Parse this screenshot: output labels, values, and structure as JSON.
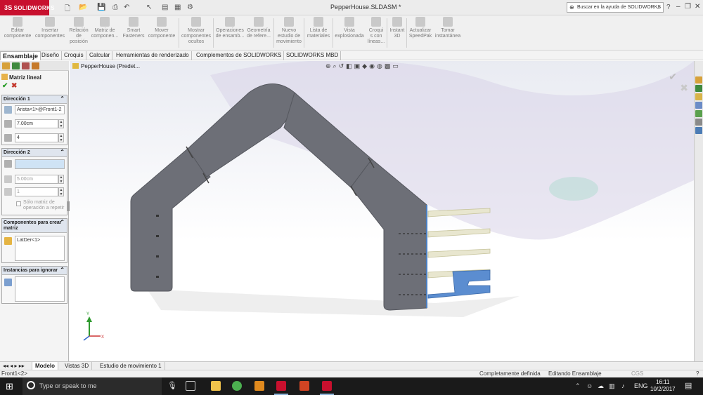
{
  "titlebar": {
    "logo_brand": "SOLIDWORKS",
    "logo_mark": "3S",
    "document_title": "PepperHouse.SLDASM *",
    "help_search_placeholder": "Buscar en la ayuda de SOLIDWORKS"
  },
  "command_manager": [
    {
      "label": "Editar\ncomponente"
    },
    {
      "label": "Insertar\ncomponentes"
    },
    {
      "label": "Relación\nde\nposición"
    },
    {
      "label": "Matriz de\ncomponen..."
    },
    {
      "label": "Smart\nFasteners"
    },
    {
      "label": "Mover\ncomponente"
    },
    {
      "label": "Mostrar\ncomponentes\nocultos"
    },
    {
      "label": "Operaciones\nde ensamb..."
    },
    {
      "label": "Geometría\nde refere..."
    },
    {
      "label": "Nuevo\nestudio de\nmovimiento"
    },
    {
      "label": "Lista de\nmateriales"
    },
    {
      "label": "Vista\nexplosionada"
    },
    {
      "label": "Croqui\ns con\nlíneas..."
    },
    {
      "label": "Instant\n3D"
    },
    {
      "label": "Actualizar\nSpeedPak"
    },
    {
      "label": "Tomar\ninstantánea"
    }
  ],
  "tabs": [
    "Ensamblaje",
    "Diseño",
    "Croquis",
    "Calcular",
    "Herramientas de renderizado",
    "Complementos de SOLIDWORKS",
    "SOLIDWORKS MBD"
  ],
  "property_manager": {
    "title": "Matriz lineal",
    "ok_glyph": "✔",
    "cancel_glyph": "✖",
    "direction1": {
      "header": "Dirección 1",
      "edge": "Arista<1>@Front1-2",
      "spacing": "7.00cm",
      "instances": "4"
    },
    "direction2": {
      "header": "Dirección 2",
      "edge": "",
      "spacing": "5.00cm",
      "instances": "1",
      "checkbox_label": "Sólo matriz de operación a repetir"
    },
    "components": {
      "header": "Componentes para crear matriz",
      "item": "LatDer<1>"
    },
    "skip": {
      "header": "Instancias para ignorar"
    }
  },
  "viewport": {
    "crumb": "PepperHouse  (Predet..."
  },
  "bottom_tabs": [
    "Modelo",
    "Vistas 3D",
    "Estudio de movimiento 1"
  ],
  "status": {
    "left": "Front1<2>",
    "defined": "Completamente definida",
    "mode": "Editando Ensamblaje",
    "units": "CGS"
  },
  "taskbar": {
    "search_placeholder": "Type or speak to me",
    "language": "ENG",
    "time": "16:11",
    "date": "10/2/2017"
  },
  "colors": {
    "solidworks_red": "#c8102e",
    "part_gray": "#6d6f77",
    "selected_blue": "#4a7fc2",
    "preview_beige": "#e8e6cf"
  }
}
